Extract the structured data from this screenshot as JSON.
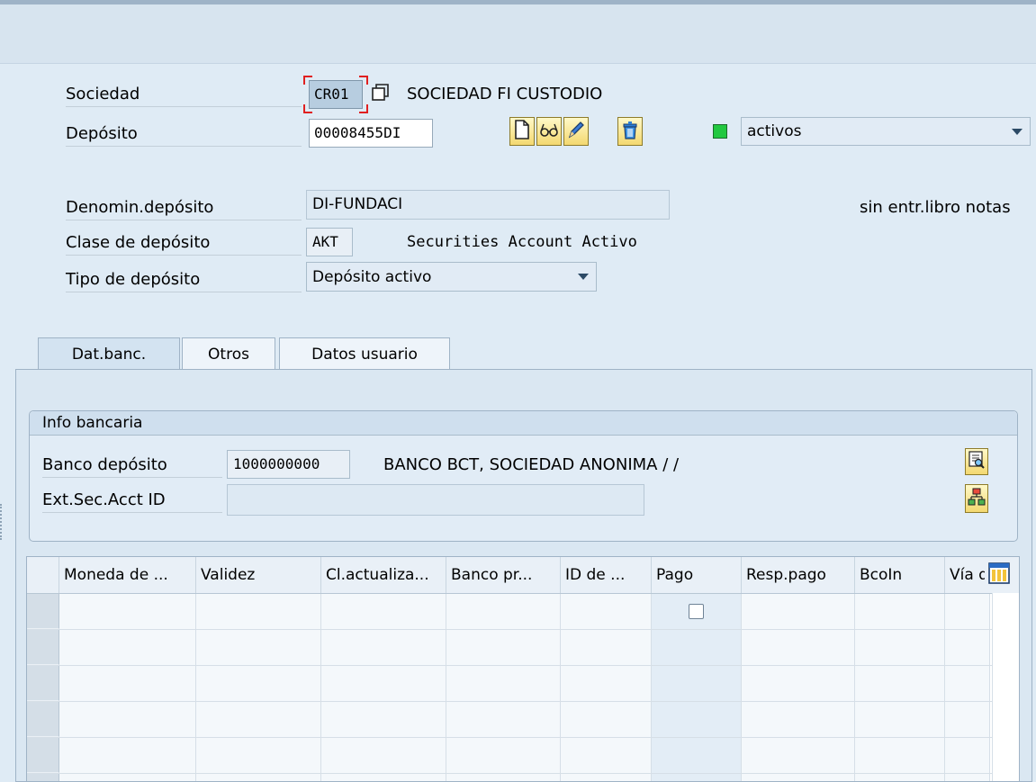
{
  "header": {
    "sociedad_label": "Sociedad",
    "sociedad_value": "CR01",
    "sociedad_desc": "SOCIEDAD FI CUSTODIO",
    "deposito_label": "Depósito",
    "deposito_value": "00008455DI",
    "status_color": "#22c840",
    "status_select": "activos",
    "denomin_label": "Denomin.depósito",
    "denomin_value": "DI-FUNDACI",
    "notes_text": "sin entr.libro notas",
    "clase_label": "Clase de depósito",
    "clase_value": "AKT",
    "clase_desc": "Securities Account Activo",
    "tipo_label": "Tipo de depósito",
    "tipo_value": "Depósito activo"
  },
  "toolbar_icons": [
    "new-document-icon",
    "glasses-display-icon",
    "pencil-edit-icon",
    "trash-delete-icon"
  ],
  "tabs": [
    "Dat.banc.",
    "Otros",
    "Datos usuario"
  ],
  "info_bancaria": {
    "title": "Info bancaria",
    "banco_label": "Banco depósito",
    "banco_value": "1000000000",
    "banco_desc": "BANCO BCT, SOCIEDAD ANONIMA / /",
    "ext_label": "Ext.Sec.Acct ID",
    "ext_value": ""
  },
  "grid": {
    "columns": [
      "Moneda de ...",
      "Validez",
      "Cl.actualiza...",
      "Banco pr...",
      "ID de ...",
      "Pago",
      "Resp.pago",
      "BcoIn",
      "Vía d"
    ]
  }
}
